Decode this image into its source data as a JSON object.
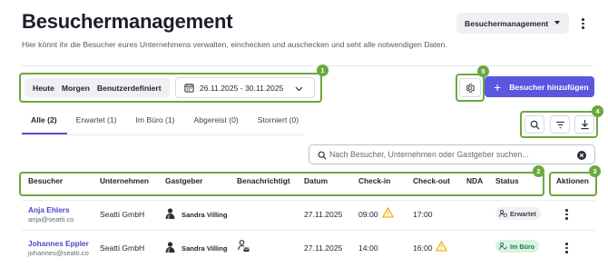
{
  "header": {
    "title": "Besuchermanagement",
    "subtitle": "Hier könnt ihr die Besucher eures Unternehmens verwalten, einchecken und auschecken und seht alle notwendigen Daten.",
    "workspace_label": "Besuchermanagement"
  },
  "filters": {
    "periods": [
      "Heute",
      "Morgen",
      "Benutzerdefiniert"
    ],
    "date_range": "26.11.2025 - 30.11.2025"
  },
  "actions": {
    "add_label": "Besucher hinzufügen"
  },
  "tabs": [
    {
      "label": "Alle (2)",
      "active": true
    },
    {
      "label": "Erwartet (1)"
    },
    {
      "label": "Im Büro (1)"
    },
    {
      "label": "Abgereist (0)"
    },
    {
      "label": "Storniert (0)"
    }
  ],
  "search": {
    "placeholder": "Nach Besucher, Unternehmen oder Gastgeber suchen..."
  },
  "table": {
    "columns": [
      "Besucher",
      "Unternehmen",
      "Gastgeber",
      "Benachrichtigt",
      "Datum",
      "Check-in",
      "Check-out",
      "NDA",
      "Status",
      "Aktionen"
    ],
    "rows": [
      {
        "name": "Anja Ehlers",
        "email": "anja@seatti.co",
        "company": "Seatti GmbH",
        "host": "Sandra Villing",
        "notified": false,
        "date": "27.11.2025",
        "checkin": "09:00",
        "checkin_warn": true,
        "checkout": "17:00",
        "checkout_warn": false,
        "status": "Erwartet",
        "status_color": "#f0f0f3"
      },
      {
        "name": "Johannes Eppler",
        "email": "johannes@seatti.co",
        "company": "Seatti GmbH",
        "host": "Sandra Villing",
        "notified": true,
        "date": "27.11.2025",
        "checkin": "14:00",
        "checkin_warn": false,
        "checkout": "16:00",
        "checkout_warn": true,
        "status": "Im Büro",
        "status_color": "#d9f3e3"
      }
    ]
  },
  "callouts": [
    "1",
    "2",
    "3",
    "4",
    "5"
  ],
  "colors": {
    "accent": "#5a56e0",
    "highlight": "#6aa83f",
    "warning": "#f2b218"
  }
}
